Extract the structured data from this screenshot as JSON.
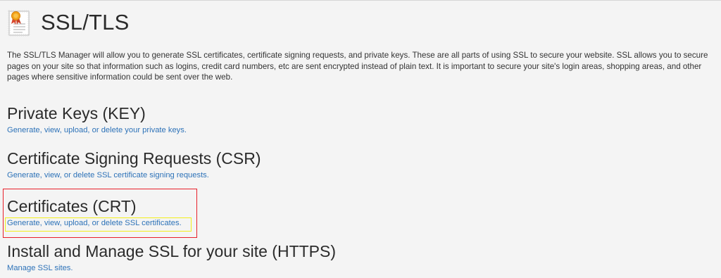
{
  "page": {
    "title": "SSL/TLS",
    "icon": "certificate-icon",
    "intro": "The SSL/TLS Manager will allow you to generate SSL certificates, certificate signing requests, and private keys. These are all parts of using SSL to secure your website. SSL allows you to secure pages on your site so that information such as logins, credit card numbers, etc are sent encrypted instead of plain text. It is important to secure your site's login areas, shopping areas, and other pages where sensitive information could be sent over the web."
  },
  "sections": [
    {
      "heading": "Private Keys (KEY)",
      "link": "Generate, view, upload, or delete your private keys."
    },
    {
      "heading": "Certificate Signing Requests (CSR)",
      "link": "Generate, view, or delete SSL certificate signing requests."
    },
    {
      "heading": "Certificates (CRT)",
      "link": "Generate, view, upload, or delete SSL certificates."
    },
    {
      "heading": "Install and Manage SSL for your site (HTTPS)",
      "link": "Manage SSL sites."
    }
  ],
  "colors": {
    "link": "#2d72b8",
    "highlight_outer": "#e8202a",
    "highlight_inner": "#f2ee1a",
    "background": "#f4f4f4"
  }
}
